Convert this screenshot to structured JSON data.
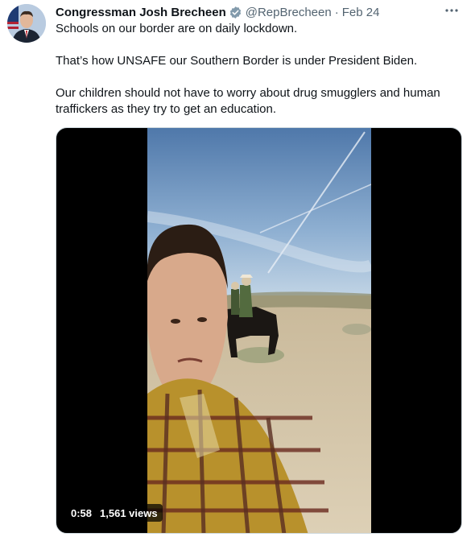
{
  "tweet": {
    "author_name": "Congressman Josh Brecheen",
    "handle": "@RepBrecheen",
    "separator": "·",
    "date": "Feb 24",
    "paragraphs": [
      "Schools on our border are on daily lockdown.",
      "That’s how UNSAFE our Southern Border is under President Biden.",
      "Our children should not have to worry about drug smugglers and human traffickers as they try to get an education."
    ]
  },
  "media": {
    "duration": "0:58",
    "views": "1,561 views"
  },
  "icons": {
    "verified": "verified-badge-icon",
    "more": "more-options-icon"
  },
  "colors": {
    "text": "#0f1419",
    "secondary": "#536471",
    "verified": "#829aab"
  }
}
